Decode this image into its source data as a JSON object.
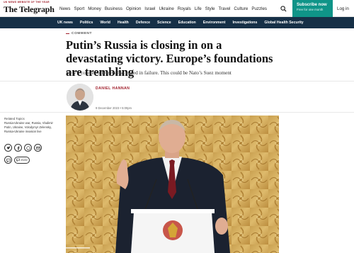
{
  "header": {
    "award": "UK NEWS WEBSITE OF THE YEAR",
    "logo": "The Telegraph",
    "nav": [
      "News",
      "Sport",
      "Money",
      "Business",
      "Opinion",
      "Israel",
      "Ukraine",
      "Royals",
      "Life",
      "Style",
      "Travel",
      "Culture",
      "Puzzles"
    ],
    "subscribe_label": "Subscribe now",
    "subscribe_sub": "Free for one month",
    "login_label": "Log in"
  },
  "section_nav": [
    "UK news",
    "Politics",
    "World",
    "Health",
    "Defence",
    "Science",
    "Education",
    "Environment",
    "Investigations",
    "Global Health Security"
  ],
  "article": {
    "kicker": "COMMENT",
    "headline": "Putin’s Russia is closing in on a devastating victory. Europe’s foundations are trembling",
    "standfirst": "Kyiv’s counter-offensive has ended in failure. This could be Nato’s Suez moment",
    "author": "DANIEL HANNAN",
    "date": "9 December 2023 • 5:00pm"
  },
  "sidebar": {
    "related_heading": "Related Topics",
    "related_topics": "Russia-Ukraine war, Russia, Vladimir Putin, Ukraine, Volodymyr Zelensky, Russia-Ukraine invasion live",
    "comment_count": "2142"
  },
  "icons": {
    "search": "search-icon",
    "share": [
      "twitter-icon",
      "facebook-icon",
      "whatsapp-icon",
      "email-icon"
    ],
    "comment": "comment-icon"
  },
  "colors": {
    "brand_teal": "#0f9488",
    "nav_navy": "#163047",
    "accent_red": "#a01e2a"
  }
}
